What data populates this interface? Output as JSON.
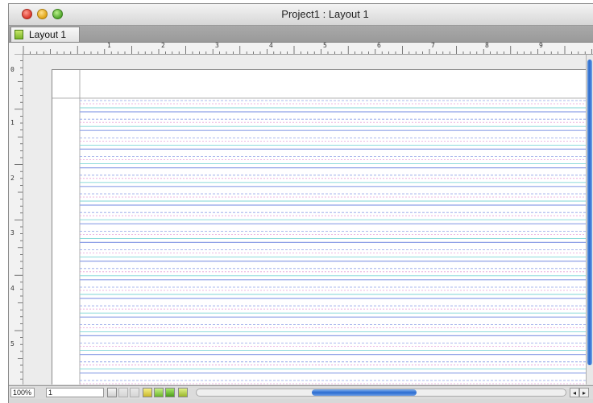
{
  "window": {
    "title": "Project1 : Layout 1"
  },
  "tabs": [
    {
      "label": "Layout 1"
    }
  ],
  "ruler": {
    "h_numbers": [
      "1",
      "2",
      "3",
      "4",
      "5",
      "6",
      "7",
      "8",
      "9"
    ],
    "v_numbers": [
      "0",
      "1",
      "2",
      "3",
      "4",
      "5"
    ]
  },
  "status": {
    "zoom": "100%",
    "page": "1"
  },
  "colors": {
    "accent": "#2a6bd0",
    "guide_blue": "#8ea0e6",
    "guide_pink": "#e6a0d8",
    "guide_cyan": "#7fd6d6"
  },
  "icons": [
    "close-icon",
    "minimize-icon",
    "zoom-icon",
    "layout-tab-icon",
    "layout-mode-icon",
    "arrow-left-icon",
    "arrow-right-icon",
    "arrow-up-icon",
    "arrow-down-icon"
  ]
}
